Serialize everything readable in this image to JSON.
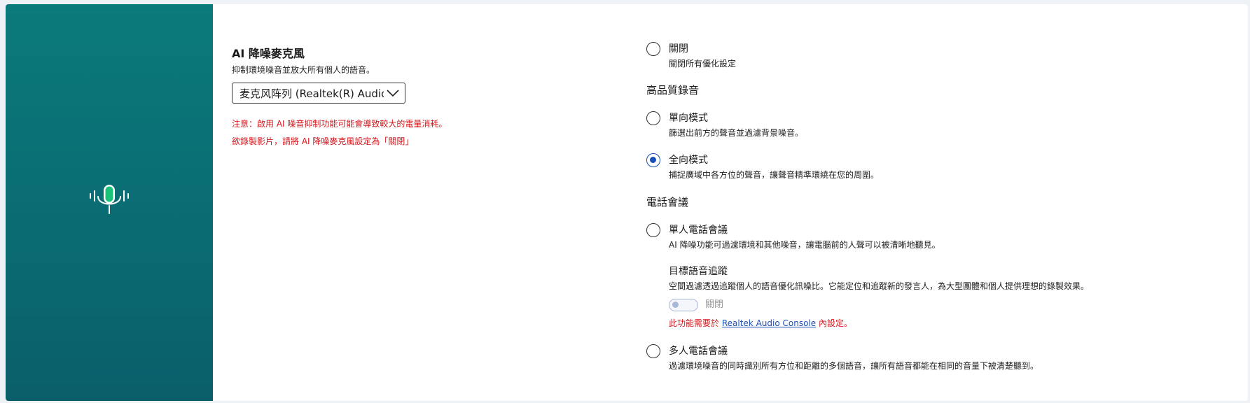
{
  "colors": {
    "sidebar": "#0b7a7a",
    "accent": "#1a4fb8",
    "warning": "#d4151a",
    "mic_green": "#19c47a"
  },
  "sidebar": {
    "icon": "microphone-icon"
  },
  "ai_mic": {
    "title": "AI 降噪麥克風",
    "description": "抑制環境噪音並放大所有個人的語音。",
    "selected_device": "麦克风阵列 (Realtek(R) Audio)",
    "warning_1": "注意：啟用 AI 噪音抑制功能可能會導致較大的電量消耗。",
    "warning_2": "欲錄製影片，請將 AI 降噪麥克風設定為「關閉」"
  },
  "modes": {
    "off": {
      "label": "關閉",
      "desc": "關閉所有優化設定",
      "checked": false
    },
    "hq_title": "高品質錄音",
    "unidirectional": {
      "label": "單向模式",
      "desc": "篩選出前方的聲音並過濾背景噪音。",
      "checked": false
    },
    "omnidirectional": {
      "label": "全向模式",
      "desc": "捕捉廣域中各方位的聲音，讓聲音精準環繞在您的周圍。",
      "checked": true
    },
    "conf_title": "電話會議",
    "single_call": {
      "label": "單人電話會議",
      "desc": "AI 降噪功能可過濾環境和其他噪音，讓電腦前的人聲可以被清晰地聽見。",
      "checked": false
    },
    "voice_tracking": {
      "title": "目標語音追蹤",
      "desc": "空間過濾透過追蹤個人的語音優化訊噪比。它能定位和追蹤新的發言人，為大型團體和個人提供理想的錄製效果。",
      "toggle_label": "關閉",
      "toggle_on": false,
      "note_prefix": "此功能需要於",
      "note_link": "Realtek Audio Console",
      "note_suffix": "內設定。"
    },
    "multi_call": {
      "label": "多人電話會議",
      "desc": "過濾環境噪音的同時識別所有方位和距離的多個語音，讓所有語音都能在相同的音量下被清楚聽到。",
      "checked": false
    }
  }
}
